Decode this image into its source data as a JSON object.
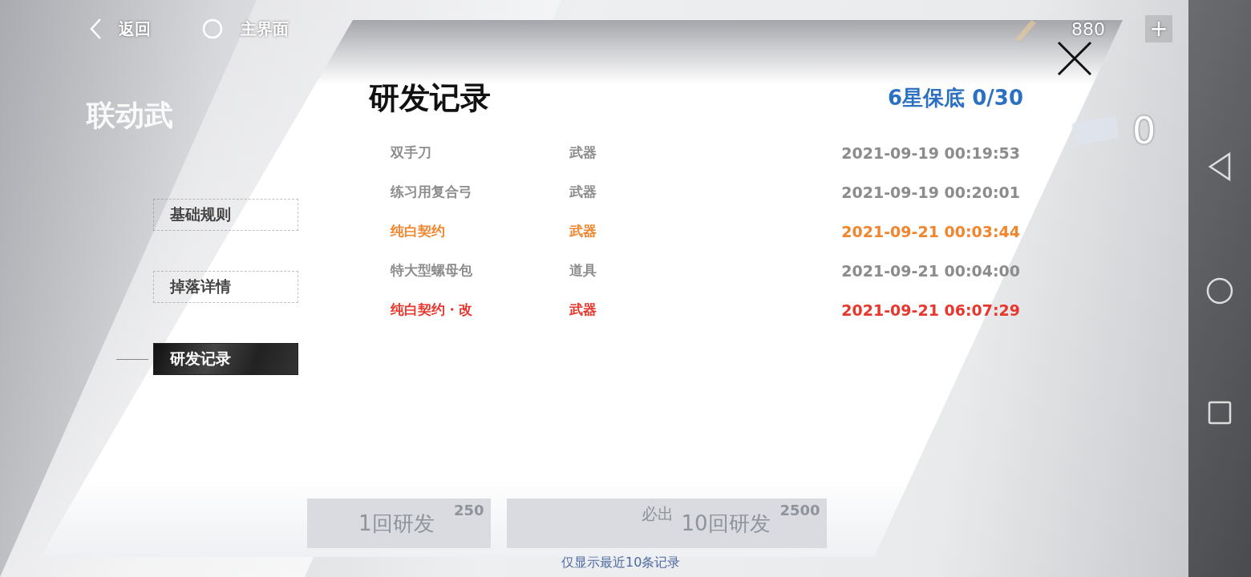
{
  "top_bar": {
    "back": "返回",
    "home": "主界面",
    "currency": "880",
    "add": "+"
  },
  "background": {
    "title": "联动武",
    "ticket_count": "0",
    "buttons": [
      {
        "label": "1回研发",
        "cost": "250"
      },
      {
        "label": "10回研发",
        "cost": "2500",
        "note": "必出"
      }
    ]
  },
  "side_tabs": [
    {
      "label": "基础规则",
      "selected": false
    },
    {
      "label": "掉落详情",
      "selected": false
    },
    {
      "label": "研发记录",
      "selected": true
    }
  ],
  "dialog": {
    "title": "研发记录",
    "pity": "6星保底 0/30",
    "records": [
      {
        "name": "双手刀",
        "type": "武器",
        "time": "2021-09-19 00:19:53",
        "color": "#8c8c8c"
      },
      {
        "name": "练习用复合弓",
        "type": "武器",
        "time": "2021-09-19 00:20:01",
        "color": "#8c8c8c"
      },
      {
        "name": "纯白契约",
        "type": "武器",
        "time": "2021-09-21 00:03:44",
        "color": "#f0862e"
      },
      {
        "name": "特大型螺母包",
        "type": "道具",
        "time": "2021-09-21 00:04:00",
        "color": "#8c8c8c"
      },
      {
        "name": "纯白契约・改",
        "type": "武器",
        "time": "2021-09-21 06:07:29",
        "color": "#e8372c"
      }
    ],
    "footer": "仅显示最近10条记录"
  }
}
